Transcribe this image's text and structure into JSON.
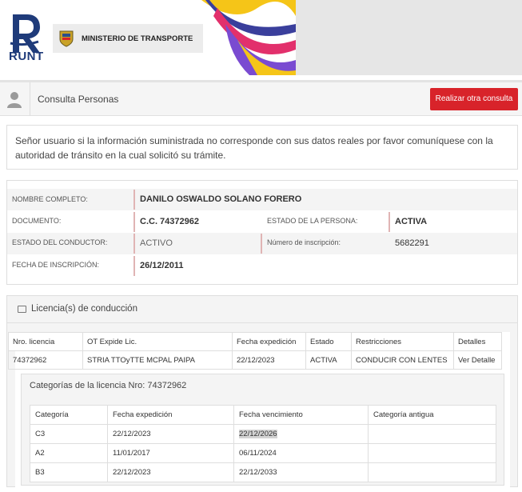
{
  "banner": {
    "runt_label": "RUNT",
    "ministry_label": "MINISTERIO DE TRANSPORTE"
  },
  "header": {
    "title": "Consulta Personas",
    "action_button": "Realizar otra consulta"
  },
  "notice": {
    "text": "Señor usuario si la información suministrada no corresponde con sus datos reales por favor comuníquese con la autoridad de tránsito en la cual solicitó su trámite."
  },
  "person": {
    "nombre_label": "NOMBRE COMPLETO:",
    "nombre_value": "DANILO OSWALDO SOLANO FORERO",
    "documento_label": "DOCUMENTO:",
    "documento_value": "C.C. 74372962",
    "estado_persona_label": "ESTADO DE LA PERSONA:",
    "estado_persona_value": "ACTIVA",
    "estado_conductor_label": "ESTADO DEL CONDUCTOR:",
    "estado_conductor_value": "ACTIVO",
    "inscripcion_num_label": "Número de inscripción:",
    "inscripcion_num_value": "5682291",
    "fecha_inscripcion_label": "FECHA DE INSCRIPCIÓN:",
    "fecha_inscripcion_value": "26/12/2011"
  },
  "licenses": {
    "section_title": "Licencia(s) de conducción",
    "columns": [
      "Nro. licencia",
      "OT Expide Lic.",
      "Fecha expedición",
      "Estado",
      "Restricciones",
      "Detalles"
    ],
    "rows": [
      [
        "74372962",
        "STRIA TTOyTTE MCPAL PAIPA",
        "22/12/2023",
        "ACTIVA",
        "CONDUCIR CON LENTES",
        "Ver Detalle"
      ]
    ]
  },
  "categories": {
    "title": "Categorías de la licencia Nro: 74372962",
    "columns": [
      "Categoría",
      "Fecha expedición",
      "Fecha vencimiento",
      "Categoría antigua"
    ],
    "rows": [
      [
        "C3",
        "22/12/2023",
        "22/12/2026",
        ""
      ],
      [
        "A2",
        "11/01/2017",
        "06/11/2024",
        ""
      ],
      [
        "B3",
        "22/12/2023",
        "22/12/2033",
        ""
      ]
    ]
  },
  "colors": {
    "accent_red": "#d8232a",
    "runt_blue": "#1f3b7a"
  }
}
